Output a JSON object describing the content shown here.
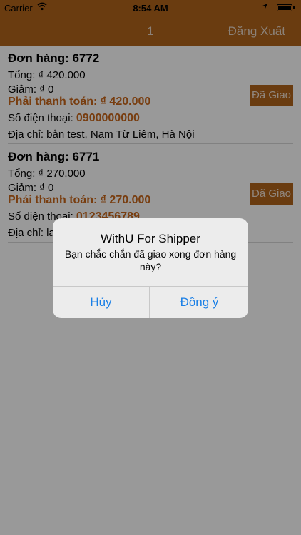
{
  "statusbar": {
    "carrier": "Carrier",
    "time": "8:54 AM"
  },
  "navbar": {
    "count": "1",
    "logout_label": "Đăng Xuất"
  },
  "orders": [
    {
      "title": "Đơn hàng: 6772",
      "total": "Tổng: ₫ 420.000",
      "discount": "Giảm: ₫ 0",
      "payable": "Phải thanh toán: ₫ 420.000",
      "phone_label": "Số điện thoại: ",
      "phone": "0900000000",
      "address": "Địa chỉ: bản test, Nam Từ Liêm, Hà Nội",
      "button_label": "Đã Giao"
    },
    {
      "title": "Đơn hàng: 6771",
      "total": "Tổng: ₫ 270.000",
      "discount": "Giảm: ₫ 0",
      "payable": "Phải thanh toán: ₫ 270.000",
      "phone_label": "Số điện thoại: ",
      "phone": "0123456789",
      "address": "Địa chỉ: la",
      "button_label": "Đã Giao"
    }
  ],
  "dialog": {
    "title": "WithU For Shipper",
    "message": "Bạn chắc chắn đã giao xong đơn hàng này?",
    "cancel_label": "Hủy",
    "confirm_label": "Đồng ý"
  },
  "colors": {
    "brand": "#b1641c",
    "accent_text": "#c8661a",
    "dialog_button": "#1a7fe6"
  },
  "icons": [
    "wifi-icon",
    "location-arrow-icon",
    "battery-icon"
  ]
}
